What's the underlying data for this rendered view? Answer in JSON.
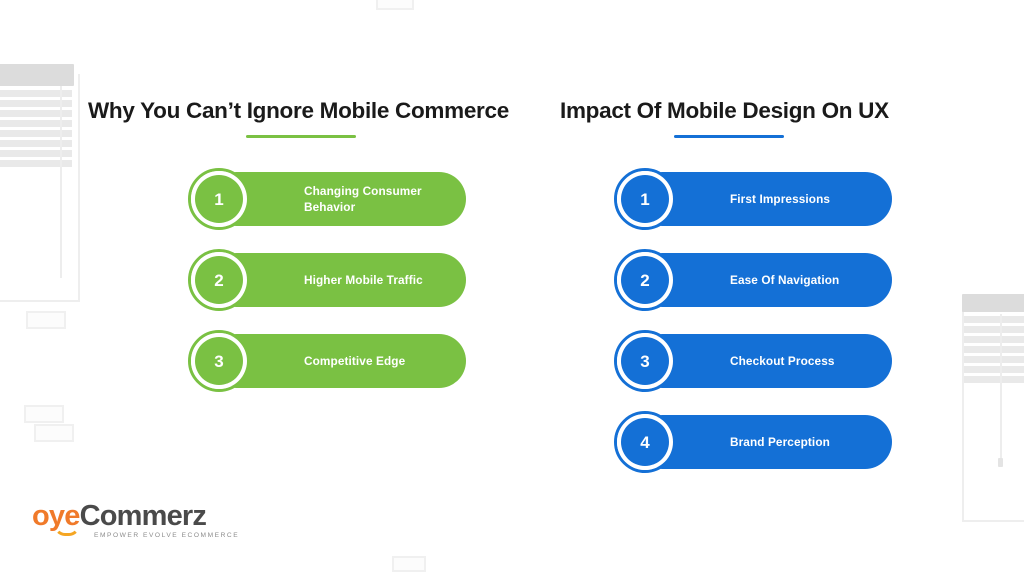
{
  "slide": {
    "background_color": "#ffffff",
    "accent_green": "#7ac143",
    "accent_blue": "#1470d6",
    "heading_color": "#1a1a1a"
  },
  "columns": [
    {
      "id": "left",
      "heading": "Why You Can’t Ignore Mobile Commerce",
      "accent": "#7ac143",
      "items": [
        {
          "number": "1",
          "label": "Changing Consumer Behavior"
        },
        {
          "number": "2",
          "label": "Higher Mobile Traffic"
        },
        {
          "number": "3",
          "label": "Competitive Edge"
        }
      ]
    },
    {
      "id": "right",
      "heading": "Impact Of Mobile Design On UX",
      "accent": "#1470d6",
      "items": [
        {
          "number": "1",
          "label": "First Impressions"
        },
        {
          "number": "2",
          "label": "Ease Of Navigation"
        },
        {
          "number": "3",
          "label": "Checkout Process"
        },
        {
          "number": "4",
          "label": "Brand Perception"
        }
      ]
    }
  ],
  "logo": {
    "brand_first": "oye",
    "brand_second": "Commerz",
    "tagline": "EMPOWER EVOLVE ECOMMERCE",
    "brand_first_color": "#f07a2a",
    "brand_second_color": "#4a4a4a"
  }
}
